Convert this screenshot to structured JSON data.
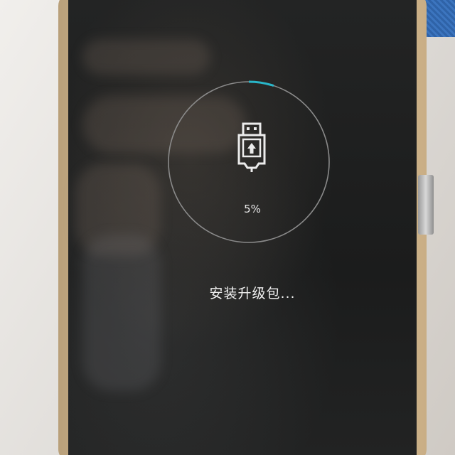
{
  "update_screen": {
    "progress_percent": 5,
    "progress_text": "5%",
    "status_text": "安装升级包...",
    "icon": "usb-upload-icon",
    "colors": {
      "screen_background": "#1f2020",
      "ring_track": "#8a8a8a",
      "ring_progress": "#29b6c9",
      "text": "#f2f2f2"
    }
  }
}
